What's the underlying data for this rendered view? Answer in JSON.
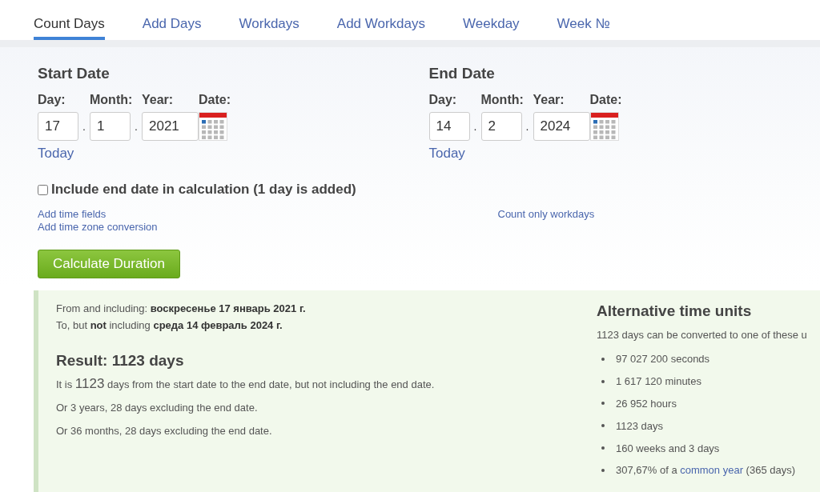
{
  "tabs": [
    {
      "label": "Count Days",
      "selected": true
    },
    {
      "label": "Add Days",
      "selected": false
    },
    {
      "label": "Workdays",
      "selected": false
    },
    {
      "label": "Add Workdays",
      "selected": false
    },
    {
      "label": "Weekday",
      "selected": false
    },
    {
      "label": "Week №",
      "selected": false
    }
  ],
  "dates": [
    {
      "title": "Start Date",
      "labels": [
        "Day:",
        "Month:",
        "Year:",
        "Date:"
      ],
      "day": "17",
      "month": "1",
      "year": "2021",
      "separator": ".",
      "today": "Today",
      "links": [
        "Add time fields",
        "Add time zone conversion"
      ]
    },
    {
      "title": "End Date",
      "labels": [
        "Day:",
        "Month:",
        "Year:",
        "Date:"
      ],
      "day": "14",
      "month": "2",
      "year": "2024",
      "separator": ".",
      "today": "Today",
      "links": [
        "Count only workdays"
      ]
    }
  ],
  "include_end": {
    "label": "Include end date in calculation (1 day is added)",
    "checked": false
  },
  "calculate_button": "Calculate Duration",
  "result": {
    "from": "From and including: **воскресенье 17 январь 2021 г.**",
    "to": "To, but **not** including **среда 14 февраль 2024 г.**",
    "heading": "Result: 1123 days",
    "sentence_start": "It is",
    "sentence_number": "1123",
    "sentence_end": "days from the start date to the end date, but not including the end date.",
    "lines": [
      "Or 3 years, 28 days excluding the end date.",
      "Or 36 months, 28 days excluding the end date."
    ]
  },
  "alternative": {
    "heading": "Alternative time units",
    "intro": "1123 days can be converted to one of these u",
    "items": [
      {
        "kind": "plain",
        "text": "97 027 200 seconds"
      },
      {
        "kind": "plain",
        "text": "1 617 120 minutes"
      },
      {
        "kind": "plain",
        "text": "26 952 hours"
      },
      {
        "kind": "plain",
        "text": "1123 days"
      },
      {
        "kind": "plain",
        "text": "160 weeks and 3 days"
      },
      {
        "kind": "link",
        "text": "307,67% of a",
        "link": "common year",
        "after": "(365 days)"
      }
    ]
  }
}
